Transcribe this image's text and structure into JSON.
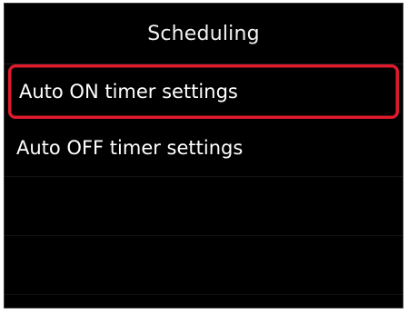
{
  "screen": {
    "title": "Scheduling"
  },
  "menu": {
    "items": [
      {
        "label": "Auto ON timer settings",
        "selected": true
      },
      {
        "label": "Auto OFF timer settings",
        "selected": false
      }
    ]
  },
  "colors": {
    "background": "#000000",
    "text": "#ffffff",
    "selection_outline": "#e01b2c"
  }
}
